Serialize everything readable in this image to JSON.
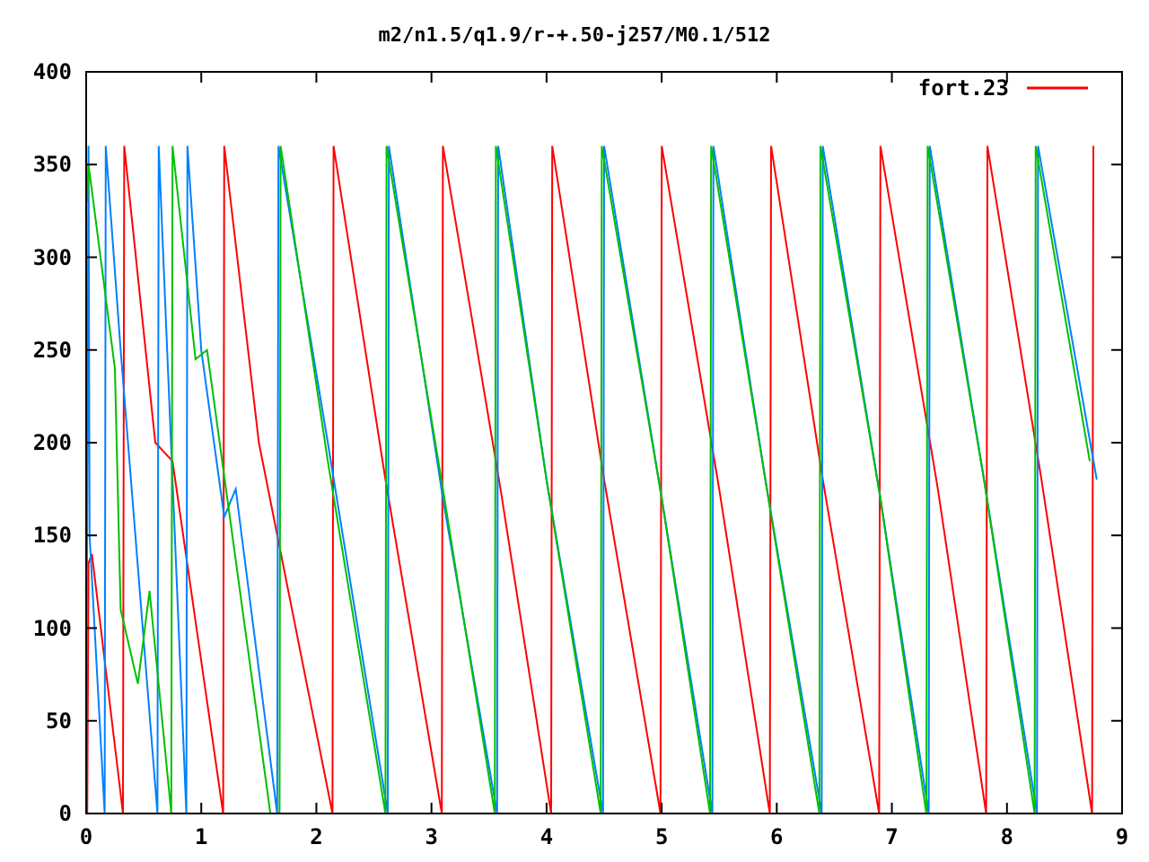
{
  "plot": {
    "chart_data": {
      "type": "line",
      "title": "m2/n1.5/q1.9/r-+.50-j257/M0.1/512",
      "xlim": [
        0,
        9
      ],
      "ylim": [
        0,
        400
      ],
      "xticks": [
        0,
        1,
        2,
        3,
        4,
        5,
        6,
        7,
        8,
        9
      ],
      "yticks": [
        0,
        50,
        100,
        150,
        200,
        250,
        300,
        350,
        400
      ],
      "series": [
        {
          "name": "fort.23",
          "color": "#ff0000",
          "x": [
            0.01,
            0.02,
            0.05,
            0.32,
            0.33,
            0.6,
            0.75,
            1.19,
            1.2,
            1.5,
            2.14,
            2.15,
            2.6,
            3.09,
            3.1,
            3.6,
            4.04,
            4.05,
            4.5,
            4.99,
            5.0,
            5.5,
            5.94,
            5.95,
            6.4,
            6.89,
            6.9,
            7.4,
            7.82,
            7.83,
            8.3,
            8.74,
            8.75
          ],
          "values": [
            0,
            135,
            140,
            0,
            360,
            200,
            190,
            0,
            360,
            200,
            0,
            360,
            180,
            0,
            360,
            175,
            0,
            360,
            180,
            0,
            360,
            175,
            0,
            360,
            180,
            0,
            360,
            175,
            0,
            360,
            180,
            0,
            360
          ]
        },
        {
          "color": "#0080ff",
          "x": [
            0.0,
            0.02,
            0.03,
            0.16,
            0.17,
            0.3,
            0.62,
            0.63,
            0.87,
            0.88,
            1.0,
            1.2,
            1.3,
            1.66,
            1.67,
            2.1,
            2.62,
            2.63,
            3.1,
            3.57,
            3.58,
            4.0,
            4.49,
            4.5,
            5.0,
            5.44,
            5.45,
            5.9,
            6.39,
            6.4,
            6.9,
            7.32,
            7.33,
            7.8,
            8.26,
            8.27,
            8.78
          ],
          "values": [
            0,
            360,
            150,
            0,
            360,
            250,
            0,
            360,
            0,
            360,
            250,
            160,
            175,
            0,
            360,
            200,
            0,
            360,
            170,
            0,
            360,
            180,
            0,
            360,
            170,
            0,
            360,
            180,
            0,
            360,
            170,
            0,
            360,
            180,
            0,
            360,
            180
          ]
        },
        {
          "color": "#00c000",
          "x": [
            0.01,
            0.02,
            0.25,
            0.3,
            0.45,
            0.55,
            0.74,
            0.75,
            0.95,
            1.05,
            1.6,
            1.68,
            1.69,
            2.1,
            2.6,
            2.61,
            3.1,
            3.55,
            3.56,
            4.0,
            4.47,
            4.48,
            5.0,
            5.42,
            5.43,
            5.9,
            6.37,
            6.38,
            6.9,
            7.3,
            7.31,
            7.8,
            8.24,
            8.25,
            8.72
          ],
          "values": [
            330,
            350,
            240,
            110,
            70,
            120,
            0,
            360,
            245,
            250,
            0,
            0,
            360,
            190,
            0,
            360,
            175,
            0,
            360,
            180,
            0,
            360,
            170,
            0,
            360,
            180,
            0,
            360,
            170,
            0,
            360,
            180,
            0,
            360,
            190
          ]
        }
      ]
    }
  }
}
